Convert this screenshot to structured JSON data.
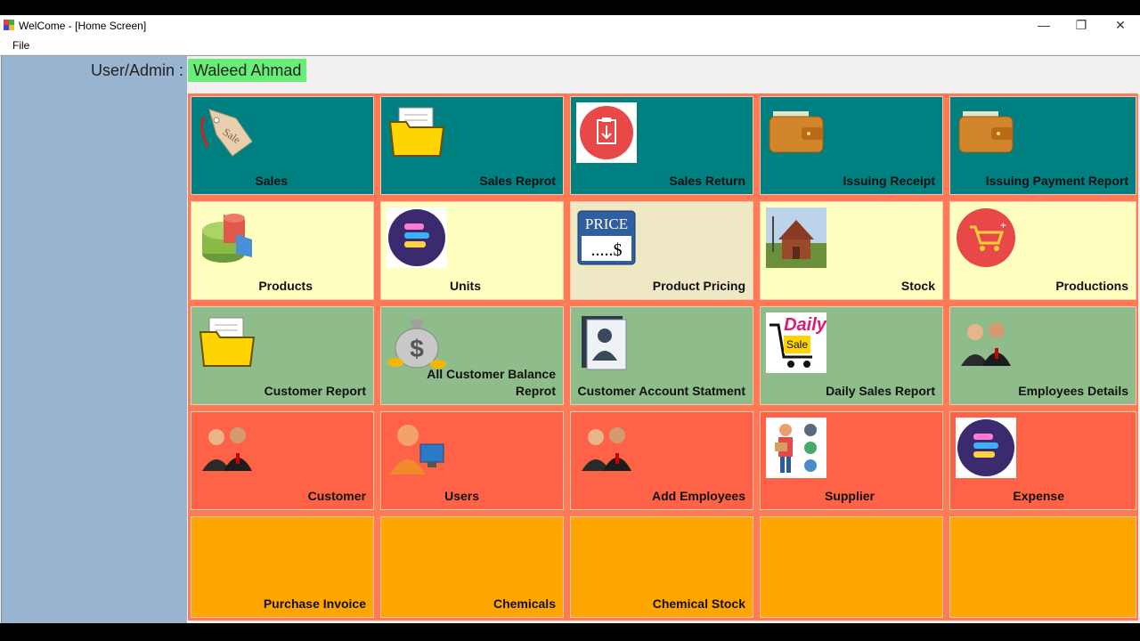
{
  "window": {
    "title": "WelCome - [Home Screen]",
    "controls": {
      "minimize": "—",
      "restore": "❐",
      "close": "✕"
    }
  },
  "menu": {
    "file": "File"
  },
  "user": {
    "label": "User/Admin :",
    "name": "Waleed Ahmad"
  },
  "colors": {
    "sidebar": "#99b4d1",
    "grid_bg": "#ff7a55",
    "teal": "#008080",
    "yellow": "#ffffc0",
    "green": "#8fbc8b",
    "red": "#ff6347",
    "orange": "#ffa500",
    "username_bg": "#66ee77"
  },
  "tiles": {
    "sales": {
      "label": "Sales",
      "icon": "sale-tag-icon"
    },
    "sales_reprot": {
      "label": "Sales Reprot",
      "icon": "folder-icon"
    },
    "sales_return": {
      "label": "Sales Return",
      "icon": "clipboard-return-icon"
    },
    "issuing_receipt": {
      "label": "Issuing Receipt",
      "icon": "wallet-icon"
    },
    "issuing_payment_report": {
      "label": "Issuing Payment Report",
      "icon": "wallet-icon"
    },
    "products": {
      "label": "Products",
      "icon": "pie-chart-icon"
    },
    "units": {
      "label": "Units",
      "icon": "stack-icon"
    },
    "product_pricing": {
      "label": "Product Pricing",
      "icon": "price-tag-icon"
    },
    "stock": {
      "label": "Stock",
      "icon": "house-icon"
    },
    "productions": {
      "label": "Productions",
      "icon": "cart-icon"
    },
    "customer_report": {
      "label": "Customer Report",
      "icon": "folder-icon"
    },
    "all_customer_balance": {
      "label": "All Customer Balance\nReprot",
      "icon": "money-bag-icon"
    },
    "customer_account": {
      "label": "Customer Account Statment",
      "icon": "contact-book-icon"
    },
    "daily_sales_report": {
      "label": "Daily Sales Report",
      "icon": "daily-sale-icon"
    },
    "employees_details": {
      "label": "Employees Details",
      "icon": "people-icon"
    },
    "customer": {
      "label": "Customer",
      "icon": "people-icon"
    },
    "users": {
      "label": "Users",
      "icon": "user-computer-icon"
    },
    "add_employees": {
      "label": "Add Employees",
      "icon": "people-icon"
    },
    "supplier": {
      "label": "Supplier",
      "icon": "delivery-man-icon"
    },
    "expense": {
      "label": "Expense",
      "icon": "stack-icon"
    },
    "purchase_invoice": {
      "label": "Purchase Invoice"
    },
    "chemicals": {
      "label": "Chemicals"
    },
    "chemical_stock": {
      "label": "Chemical Stock"
    }
  }
}
